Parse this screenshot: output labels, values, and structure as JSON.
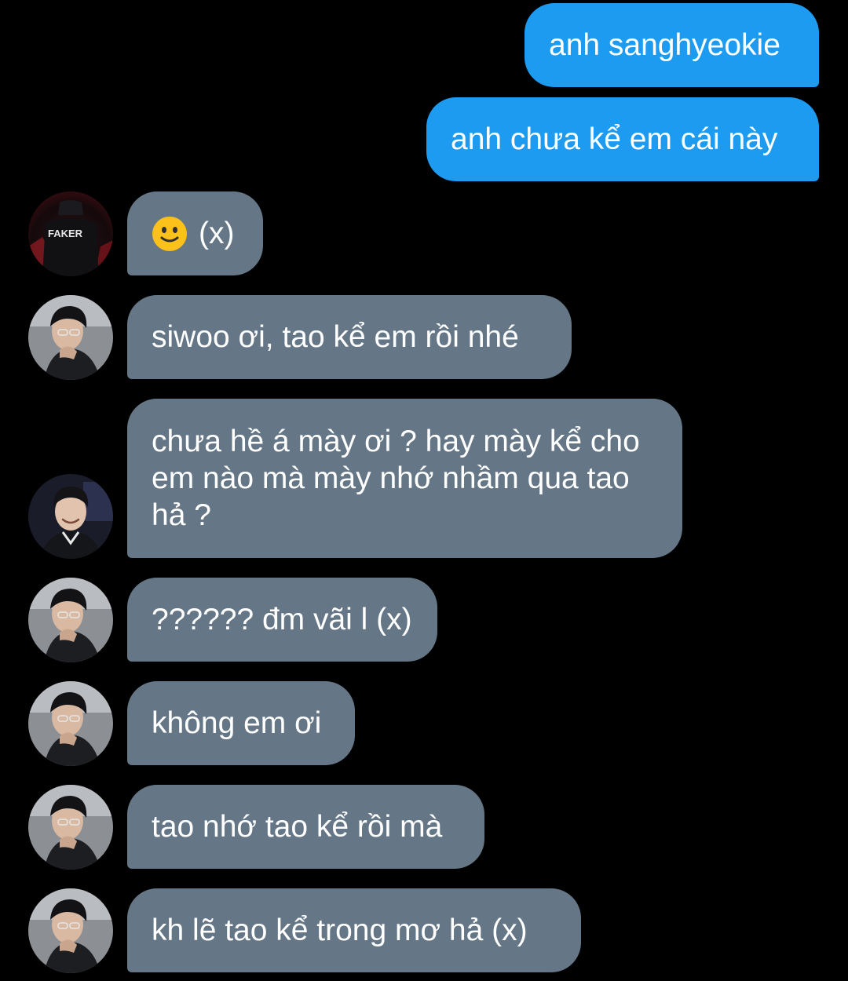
{
  "messages": [
    {
      "dir": "out",
      "text": "anh sanghyeokie"
    },
    {
      "dir": "out",
      "text": "anh chưa kể em cái này"
    },
    {
      "dir": "in",
      "avatar": "faker",
      "emoji": "slightly-smiling-face-icon",
      "text": "(x)"
    },
    {
      "dir": "in",
      "avatar": "dark-hair",
      "text": "siwoo ơi, tao kể em rồi nhé"
    },
    {
      "dir": "in",
      "avatar": "smiling",
      "text": "chưa hề á mày ơi ? hay mày kể cho em nào mà mày nhớ nhầm qua tao hả ?"
    },
    {
      "dir": "in",
      "avatar": "dark-hair",
      "text": "?????? đm vãi l (x)"
    },
    {
      "dir": "in",
      "avatar": "dark-hair",
      "text": "không em ơi"
    },
    {
      "dir": "in",
      "avatar": "dark-hair",
      "text": "tao nhớ tao kể rồi mà"
    },
    {
      "dir": "in",
      "avatar": "dark-hair",
      "text": "kh lẽ tao kể trong mơ hả (x)"
    }
  ],
  "avatar_faker": {
    "label": "FAKER"
  },
  "colors": {
    "background": "#000000",
    "outgoing_bubble": "#1d9bf0",
    "incoming_bubble": "#657786",
    "text": "#ffffff"
  }
}
